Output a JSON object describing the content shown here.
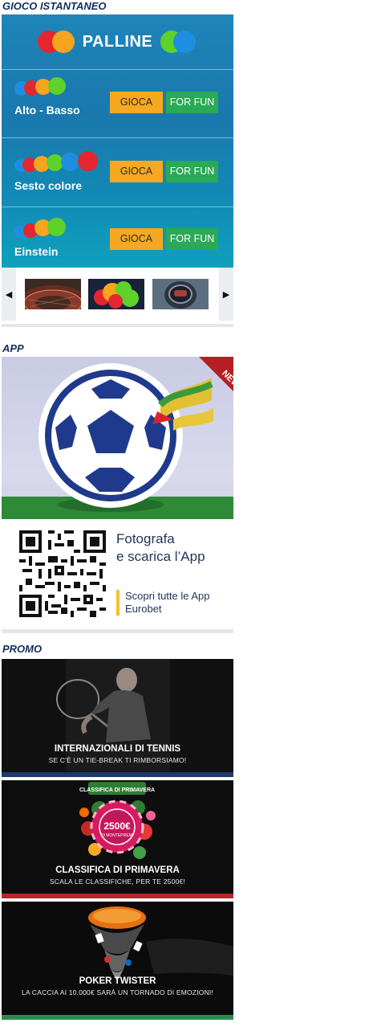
{
  "sections": {
    "instant_game": "GIOCO ISTANTANEO",
    "app": "APP",
    "promo": "PROMO"
  },
  "instant_game": {
    "title": "PALLINE",
    "games": [
      {
        "name": "Alto - Basso",
        "play_label": "GIOCA",
        "fun_label": "FOR FUN"
      },
      {
        "name": "Sesto colore",
        "play_label": "GIOCA",
        "fun_label": "FOR FUN"
      },
      {
        "name": "Einstein",
        "play_label": "GIOCA",
        "fun_label": "FOR FUN"
      }
    ],
    "carousel": {
      "prev_icon": "◀",
      "next_icon": "▶",
      "thumbs": [
        "roulette-thumbnail",
        "palline-thumbnail",
        "astronaut-thumbnail"
      ]
    },
    "colors": {
      "play": "#f5a820",
      "fun": "#2aa957"
    }
  },
  "app": {
    "badge": "NEW",
    "headline_line1": "Fotografa",
    "headline_line2": "e scarica l’App",
    "link_line1": "Scopri tutte le App",
    "link_line2": "Eurobet"
  },
  "promos": [
    {
      "title": "INTERNAZIONALI DI TENNIS",
      "subtitle": "SE C'È UN TIE-BREAK TI RIMBORSIAMO!",
      "bar_color": "#1d3a6e"
    },
    {
      "title": "CLASSIFICA DI PRIMAVERA",
      "subtitle": "SCALA LE CLASSIFICHE, PER TE 2500€!",
      "bar_color": "#b8242a",
      "badge_line1": "CLASSIFICA DI PRIMAVERA",
      "badge_amount": "2500€",
      "badge_line2": "DI MONTEPREMI"
    },
    {
      "title": "POKER TWISTER",
      "subtitle": "LA CACCIA AI 10.000€ SARÀ UN TORNADO DI EMOZIONI!",
      "bar_color": "#2c8a4f"
    }
  ]
}
